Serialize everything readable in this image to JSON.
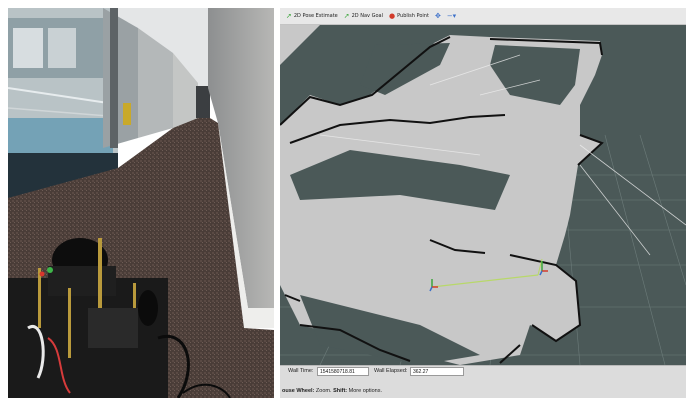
{
  "toolbar": {
    "pose_estimate_label": "2D Pose Estimate",
    "nav_goal_label": "2D Nav Goal",
    "publish_point_label": "Publish Point",
    "pose_estimate_icon": "green-arrow-icon",
    "nav_goal_icon": "green-arrow-icon",
    "publish_point_icon": "red-pin-icon",
    "move_icon": "crosshair-icon",
    "extra_icon": "minus-dropdown-icon"
  },
  "time_panel": {
    "wall_time_label": "Wall Time:",
    "wall_time_value": "1541580718.81",
    "wall_elapsed_label": "Wall Elapsed:",
    "wall_elapsed_value": "362.27"
  },
  "status_hint": {
    "mouse_wheel_prefix": "ouse Wheel:",
    "mouse_wheel_text": " Zoom. ",
    "shift_prefix": "Shift:",
    "shift_text": " More options."
  },
  "colors": {
    "viewport_bg": "#4b5958",
    "grid": "#7a8a88",
    "map_free": "#c8c8c8",
    "map_wall": "#111111",
    "path": "#b8d86a"
  }
}
